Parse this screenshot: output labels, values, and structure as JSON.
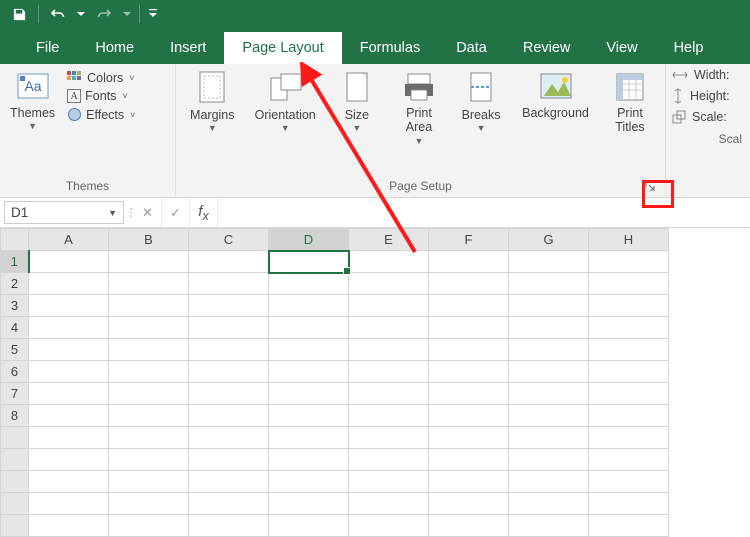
{
  "qat": {
    "save": "Save",
    "undo": "Undo",
    "redo": "Redo"
  },
  "tabs": {
    "file": "File",
    "home": "Home",
    "insert": "Insert",
    "pagelayout": "Page Layout",
    "formulas": "Formulas",
    "data": "Data",
    "review": "Review",
    "view": "View",
    "help": "Help"
  },
  "ribbon": {
    "themes": {
      "themes": "Themes",
      "colors": "Colors",
      "fonts": "Fonts",
      "effects": "Effects",
      "group_label": "Themes"
    },
    "pagesetup": {
      "margins": "Margins",
      "orientation": "Orientation",
      "size": "Size",
      "printarea": "Print\nArea",
      "breaks": "Breaks",
      "background": "Background",
      "printtitles": "Print\nTitles",
      "group_label": "Page Setup"
    },
    "scalefit": {
      "width": "Width:",
      "height": "Height:",
      "scale": "Scale:",
      "group_label": "Scal"
    }
  },
  "fx": {
    "namebox": "D1",
    "formula": ""
  },
  "grid": {
    "cols": [
      "A",
      "B",
      "C",
      "D",
      "E",
      "F",
      "G",
      "H"
    ],
    "rows": [
      "1",
      "2",
      "3",
      "4",
      "5",
      "6",
      "7",
      "8"
    ],
    "selected_cell": "D1"
  }
}
